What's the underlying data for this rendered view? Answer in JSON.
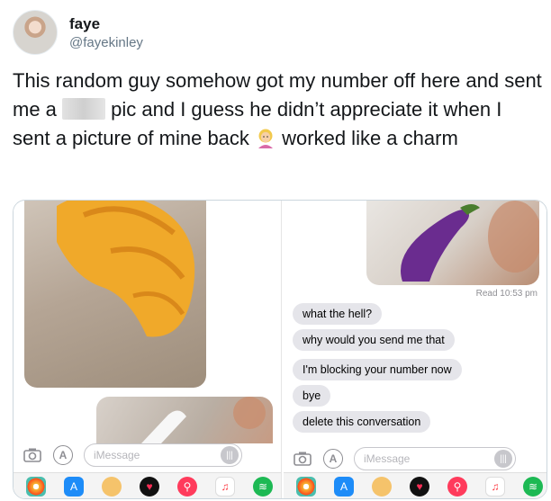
{
  "user": {
    "display_name": "faye",
    "handle": "@fayekinley"
  },
  "tweet": {
    "text_part1": "This random guy somehow got my number off here and sent me a ",
    "text_part2": " pic and I guess he didn’t appreciate it when I sent a picture of mine back ",
    "text_part3": " worked like a charm"
  },
  "conversation": {
    "read_receipt": "Read 10:53 pm",
    "messages": [
      "what the hell?",
      "why would you send me that",
      "I'm blocking your number now",
      "bye",
      "delete this conversation"
    ]
  },
  "composer": {
    "placeholder": "iMessage"
  },
  "app_tray": {
    "icons": [
      "photos-icon",
      "app-store-icon",
      "memoji-icon",
      "digital-touch-icon",
      "search-images-icon",
      "music-icon",
      "spotify-icon"
    ]
  },
  "colors": {
    "bubble_gray": "#e5e5ea",
    "handle_gray": "#657786"
  }
}
